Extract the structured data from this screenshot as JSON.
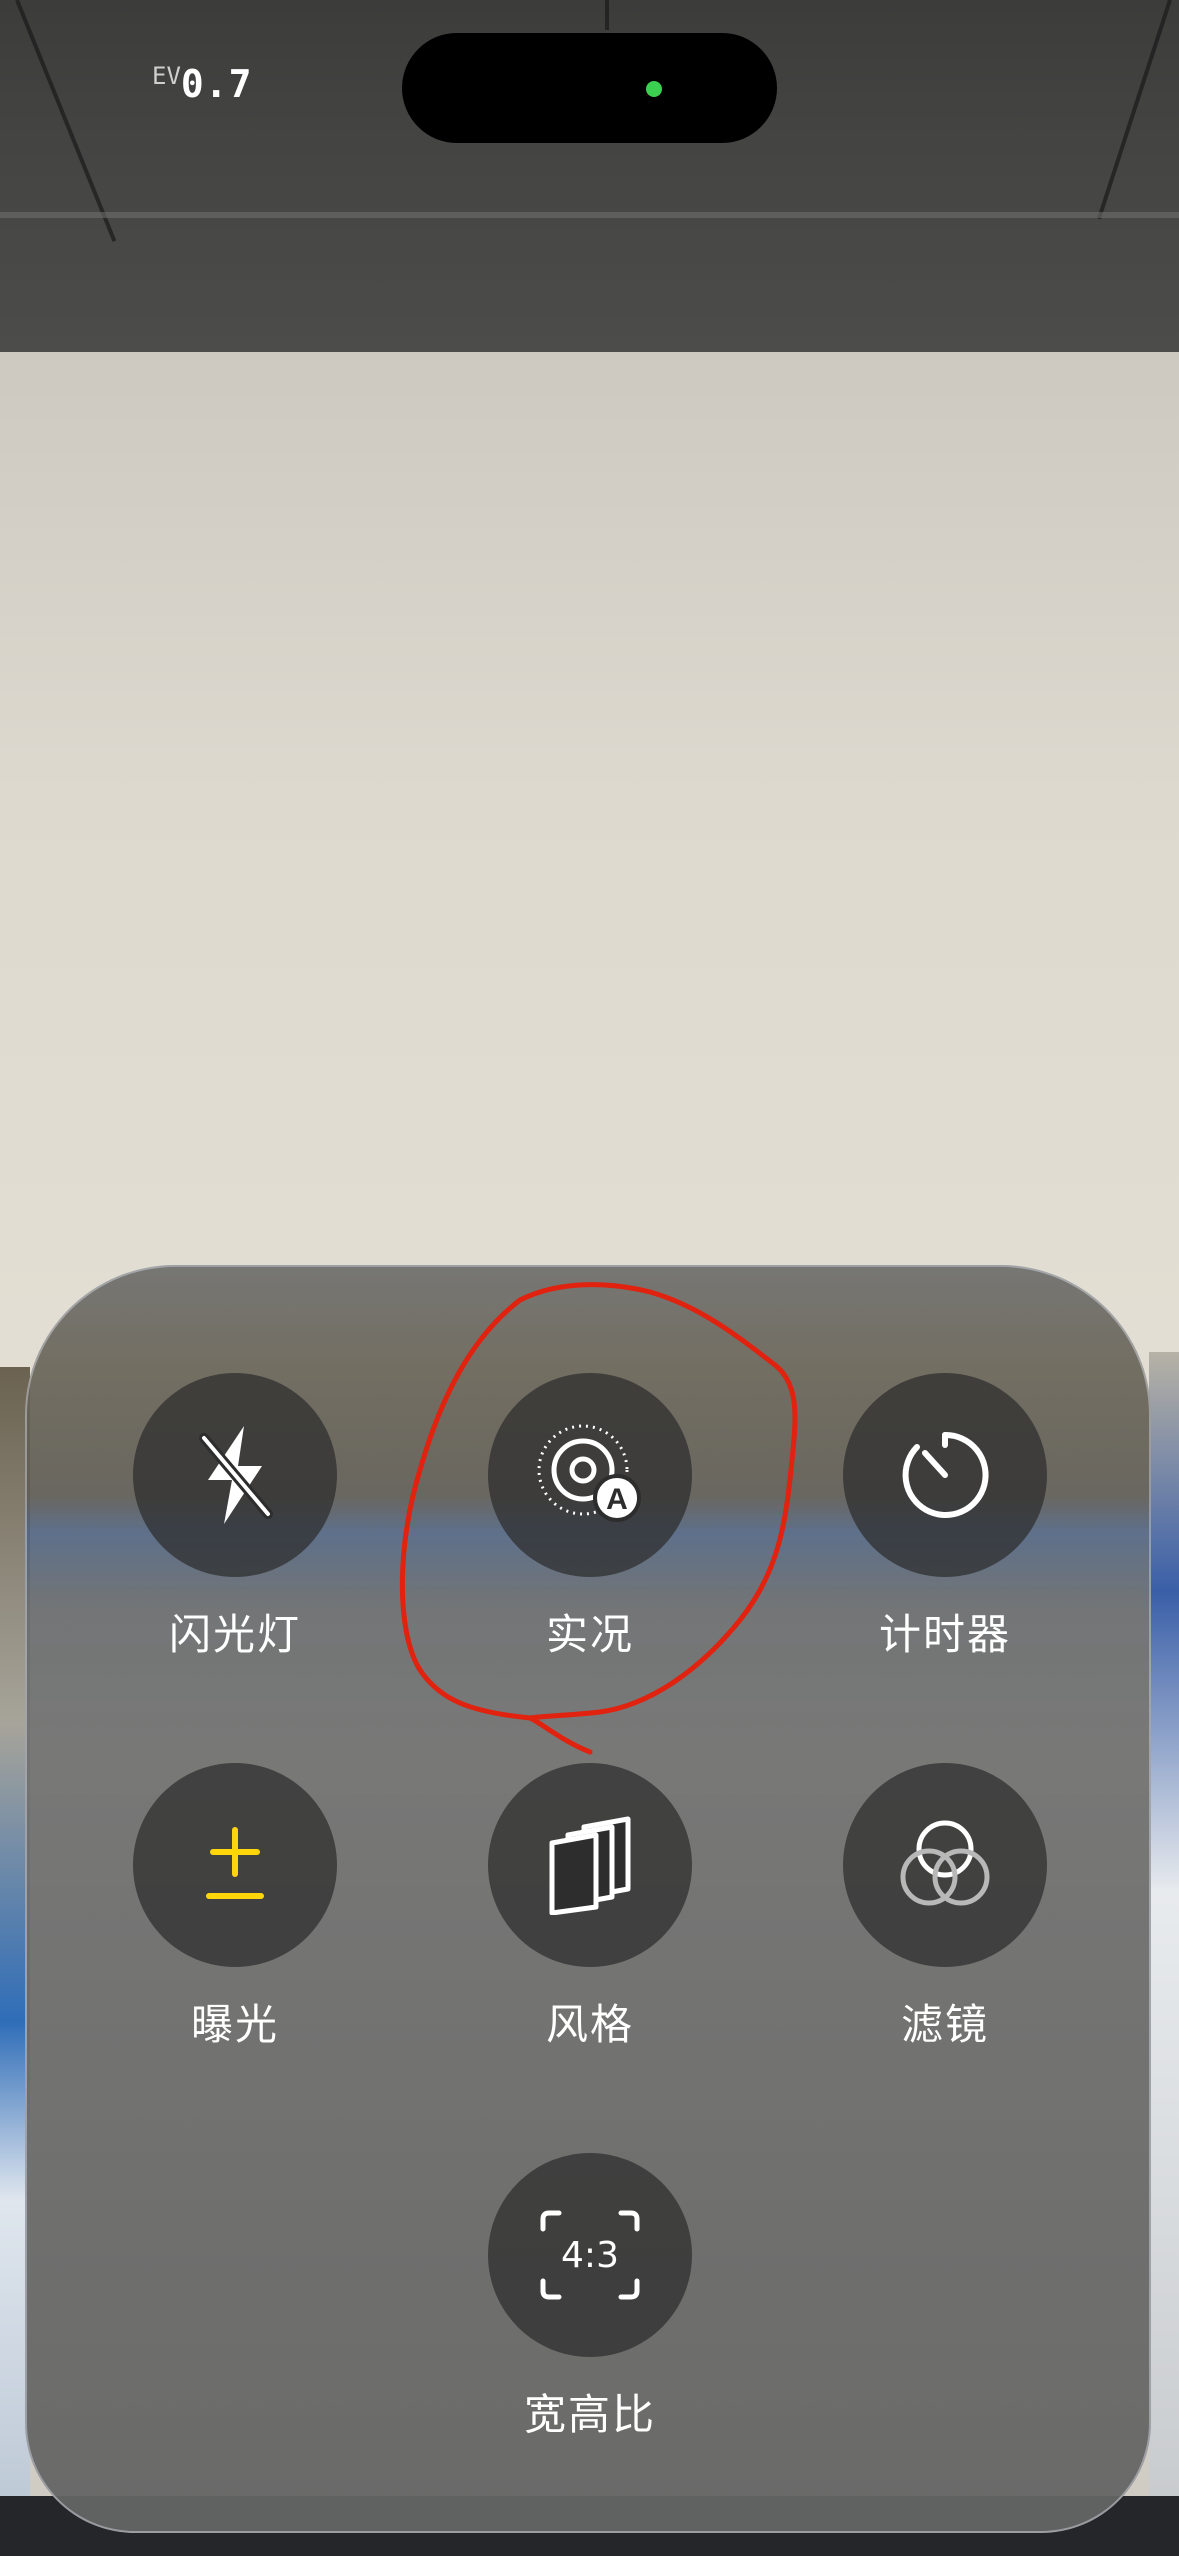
{
  "status": {
    "ev_label": "EV",
    "ev_value": "0.7"
  },
  "controls": [
    {
      "id": "flash",
      "label": "闪光灯",
      "icon": "flash-off-icon"
    },
    {
      "id": "live",
      "label": "实况",
      "icon": "live-photo-auto-icon"
    },
    {
      "id": "timer",
      "label": "计时器",
      "icon": "timer-icon"
    },
    {
      "id": "exposure",
      "label": "曝光",
      "icon": "exposure-plus-minus-icon",
      "accent": "#ffd60a"
    },
    {
      "id": "styles",
      "label": "风格",
      "icon": "photographic-styles-icon"
    },
    {
      "id": "filters",
      "label": "滤镜",
      "icon": "filters-icon"
    },
    {
      "id": "aspect",
      "label": "宽高比",
      "icon": "aspect-ratio-icon",
      "icon_text": "4:3"
    }
  ],
  "colors": {
    "accent_yellow": "#ffd60a",
    "island_dot": "#3ad150",
    "annotation_red": "#e0220f"
  }
}
